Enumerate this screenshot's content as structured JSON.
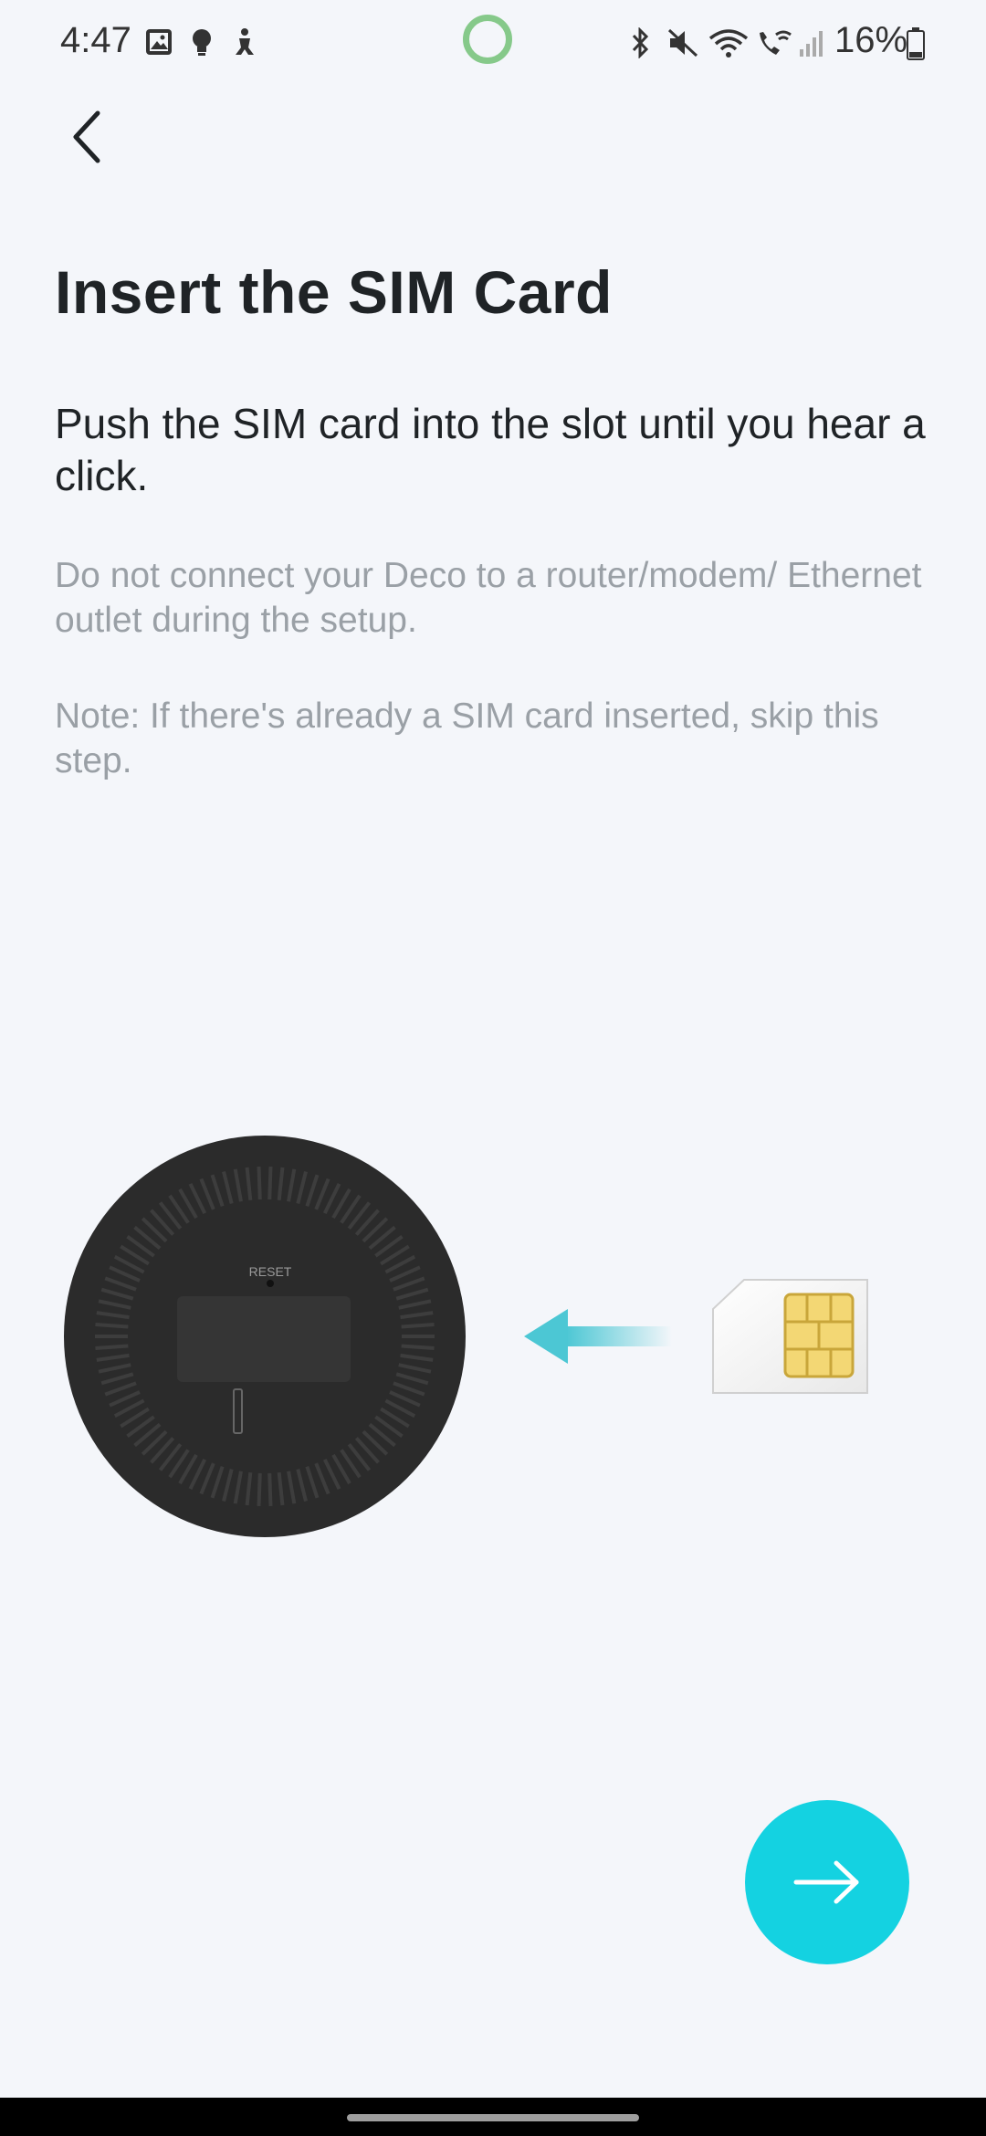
{
  "status_bar": {
    "time": "4:47",
    "battery": "16%",
    "left_icons": [
      "gallery-icon",
      "bulb-icon",
      "accessibility-icon"
    ],
    "right_icons": [
      "bluetooth-icon",
      "mute-icon",
      "wifi-icon",
      "wifi-call-icon",
      "signal-icon",
      "battery-icon"
    ],
    "record_indicator_color": "#86c98a"
  },
  "header": {
    "back_icon": "chevron-left-icon"
  },
  "content": {
    "title": "Insert the SIM Card",
    "instruction": "Push the SIM card into the slot until you hear a click.",
    "warning": "Do not connect your Deco to a router/modem/ Ethernet outlet during the setup.",
    "note": "Note: If there's already a SIM card inserted, skip this step."
  },
  "illustration": {
    "device_label": "RESET",
    "device_color": "#2b2b2b",
    "arrow_color": "#4cc7d4",
    "chip_color": "#f3d774"
  },
  "actions": {
    "next_icon": "arrow-right-icon",
    "next_color": "#14d2e1"
  }
}
